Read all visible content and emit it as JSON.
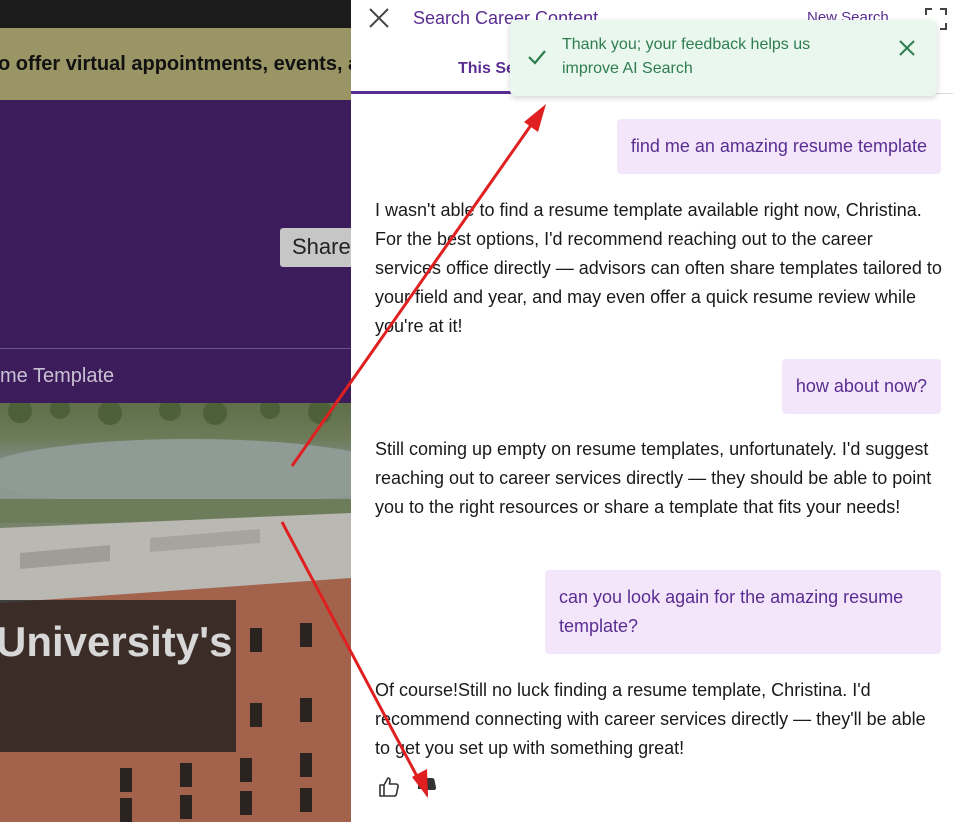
{
  "background_page": {
    "banner_text": "o offer virtual appointments, events, a",
    "share_label": "Share",
    "breadcrumb_text": "me Template",
    "hero_title": "University's"
  },
  "panel": {
    "title": "Search Career Content",
    "new_search_label": "New Search",
    "active_tab_label": "This Se"
  },
  "toast": {
    "message": "Thank you; your feedback helps us improve AI Search",
    "color": "#2e7d4f"
  },
  "conversation": [
    {
      "role": "user",
      "text": "find me an amazing resume template"
    },
    {
      "role": "assistant",
      "text": "I wasn't able to find a resume template available right now, Christina. For the best options, I'd recommend reaching out to the career services office directly — advisors can often share templates tailored to your field and year, and may even offer a quick resume review while you're at it!"
    },
    {
      "role": "user",
      "text": "how about now?"
    },
    {
      "role": "assistant",
      "text": "Still coming up empty on resume templates, unfortunately. I'd suggest reaching out to career services directly — they should be able to point you to the right resources or share a template that fits your needs!"
    },
    {
      "role": "user",
      "text": "can you look again for the amazing resume template?"
    },
    {
      "role": "assistant",
      "text": "Of course!Still no luck finding a resume template, Christina. I'd recommend connecting with career services directly — they'll be able to get you set up with something great!"
    }
  ],
  "feedback": {
    "thumbs_up_icon": "thumbs-up-outline-icon",
    "thumbs_down_icon": "thumbs-down-filled-icon",
    "selected": "thumbs-down"
  },
  "colors": {
    "accent": "#5a2d91",
    "user_bubble": "#f3e6fb",
    "annotation_arrow": "#e02020"
  }
}
